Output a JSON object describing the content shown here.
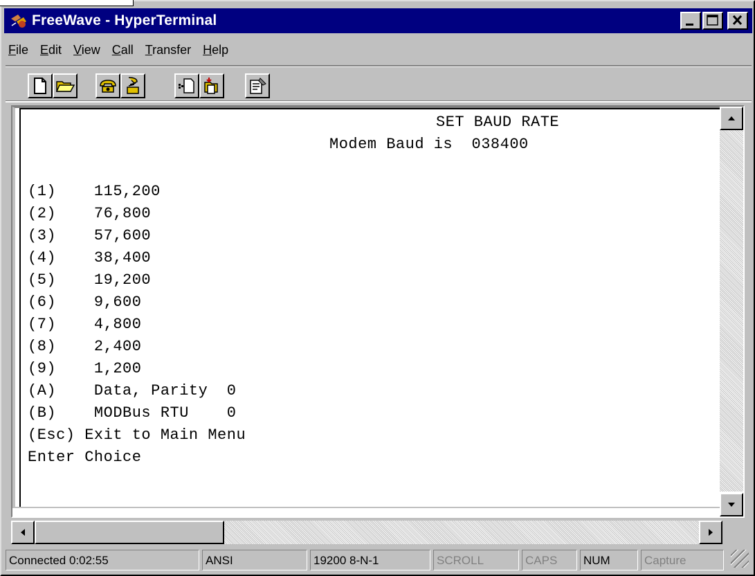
{
  "window": {
    "title": "FreeWave - HyperTerminal"
  },
  "menu": [
    {
      "label": "File",
      "u": "F",
      "rest": "ile"
    },
    {
      "label": "Edit",
      "u": "E",
      "rest": "dit"
    },
    {
      "label": "View",
      "u": "V",
      "rest": "iew"
    },
    {
      "label": "Call",
      "u": "C",
      "rest": "all"
    },
    {
      "label": "Transfer",
      "u": "T",
      "rest": "ransfer"
    },
    {
      "label": "Help",
      "u": "H",
      "rest": "elp"
    }
  ],
  "toolbar": {
    "icons": [
      "new-icon",
      "open-icon",
      "connect-icon",
      "disconnect-icon",
      "send-icon",
      "receive-icon",
      "properties-icon"
    ]
  },
  "terminal": {
    "lines": [
      "SET BAUD RATE",
      "Modem Baud is  038400",
      "(1)    115,200",
      "(2)    76,800",
      "(3)    57,600",
      "(4)    38,400",
      "(5)    19,200",
      "(6)    9,600",
      "(7)    4,800",
      "(8)    2,400",
      "(9)    1,200",
      "(A)    Data, Parity  0",
      "(B)    MODBus RTU    0",
      "(Esc) Exit to Main Menu",
      "Enter Choice"
    ]
  },
  "status": {
    "connected": "Connected 0:02:55",
    "emulation": "ANSI",
    "port_settings": "19200 8-N-1",
    "scroll": "SCROLL",
    "caps": "CAPS",
    "num": "NUM",
    "capture": "Capture"
  },
  "colors": {
    "titlebar": "#000080",
    "face": "#c0c0c0"
  }
}
